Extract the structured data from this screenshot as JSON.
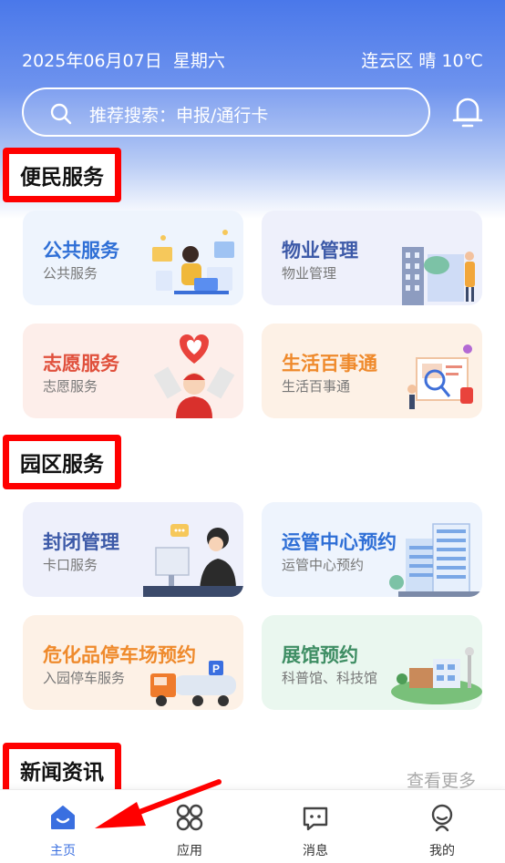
{
  "header": {
    "date": "2025年06月07日",
    "weekday": "星期六",
    "weather": "连云区 晴 10℃",
    "search_placeholder": "推荐搜索：申报/通行卡"
  },
  "sections": {
    "convenience": "便民服务",
    "park": "园区服务",
    "news": "新闻资讯"
  },
  "cards": [
    {
      "title": "公共服务",
      "subtitle": "公共服务"
    },
    {
      "title": "物业管理",
      "subtitle": "物业管理"
    },
    {
      "title": "志愿服务",
      "subtitle": "志愿服务"
    },
    {
      "title": "生活百事通",
      "subtitle": "生活百事通"
    },
    {
      "title": "封闭管理",
      "subtitle": "卡口服务"
    },
    {
      "title": "运管中心预约",
      "subtitle": "运管中心预约"
    },
    {
      "title": "危化品停车场预约",
      "subtitle": "入园停车服务"
    },
    {
      "title": "展馆预约",
      "subtitle": "科普馆、科技馆"
    }
  ],
  "news": {
    "more": "查看更多"
  },
  "tabs": [
    {
      "label": "主页",
      "icon": "home-icon",
      "active": true
    },
    {
      "label": "应用",
      "icon": "apps-icon",
      "active": false
    },
    {
      "label": "消息",
      "icon": "message-icon",
      "active": false
    },
    {
      "label": "我的",
      "icon": "profile-icon",
      "active": false
    }
  ],
  "colors": {
    "accent": "#3a6fe0",
    "annotation": "#ff0000"
  }
}
